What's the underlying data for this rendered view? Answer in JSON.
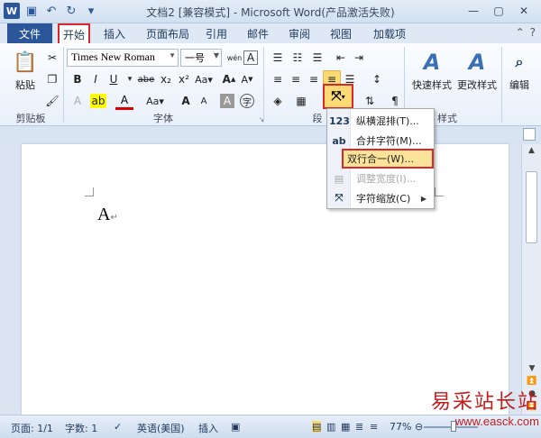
{
  "window": {
    "title": "文档2 [兼容模式] - Microsoft Word(产品激活失败)",
    "help_icon": "?"
  },
  "tabs": {
    "file": "文件",
    "items": [
      "开始",
      "插入",
      "页面布局",
      "引用",
      "邮件",
      "审阅",
      "视图",
      "加载项"
    ],
    "active_index": 0
  },
  "ribbon": {
    "clipboard": {
      "paste_label": "粘贴",
      "group_label": "剪贴板"
    },
    "font": {
      "font_name": "Times New Roman",
      "font_size": "一号",
      "wen_icon_text": "wén",
      "group_label": "字体"
    },
    "paragraph": {
      "group_label": "段"
    },
    "styles": {
      "quick_styles": "快速样式",
      "change_styles": "更改样式",
      "group_label": "样式"
    },
    "editing": {
      "label": "编辑"
    }
  },
  "dropdown_menu": {
    "items": [
      {
        "icon": "123",
        "label": "纵横混排(T)...",
        "enabled": true,
        "selected": false
      },
      {
        "icon": "ab",
        "label": "合并字符(M)...",
        "enabled": true,
        "selected": false
      },
      {
        "icon": "",
        "label": "双行合一(W)...",
        "enabled": true,
        "selected": true
      },
      {
        "icon": "",
        "label": "调整宽度(I)...",
        "enabled": false,
        "selected": false
      },
      {
        "icon": "",
        "label": "字符缩放(C)",
        "enabled": true,
        "selected": false,
        "submenu": true
      }
    ]
  },
  "document": {
    "text": "A",
    "para_mark": "↵"
  },
  "statusbar": {
    "page": "页面: 1/1",
    "words": "字数: 1",
    "language": "英语(美国)",
    "insert_mode": "插入",
    "zoom": "77%"
  },
  "watermark": {
    "line1": "易采站长站",
    "line2": "www.easck.com"
  },
  "colors": {
    "accent": "#2b579a",
    "highlight_box": "#d9272e",
    "menu_selected": "#fce39a"
  }
}
